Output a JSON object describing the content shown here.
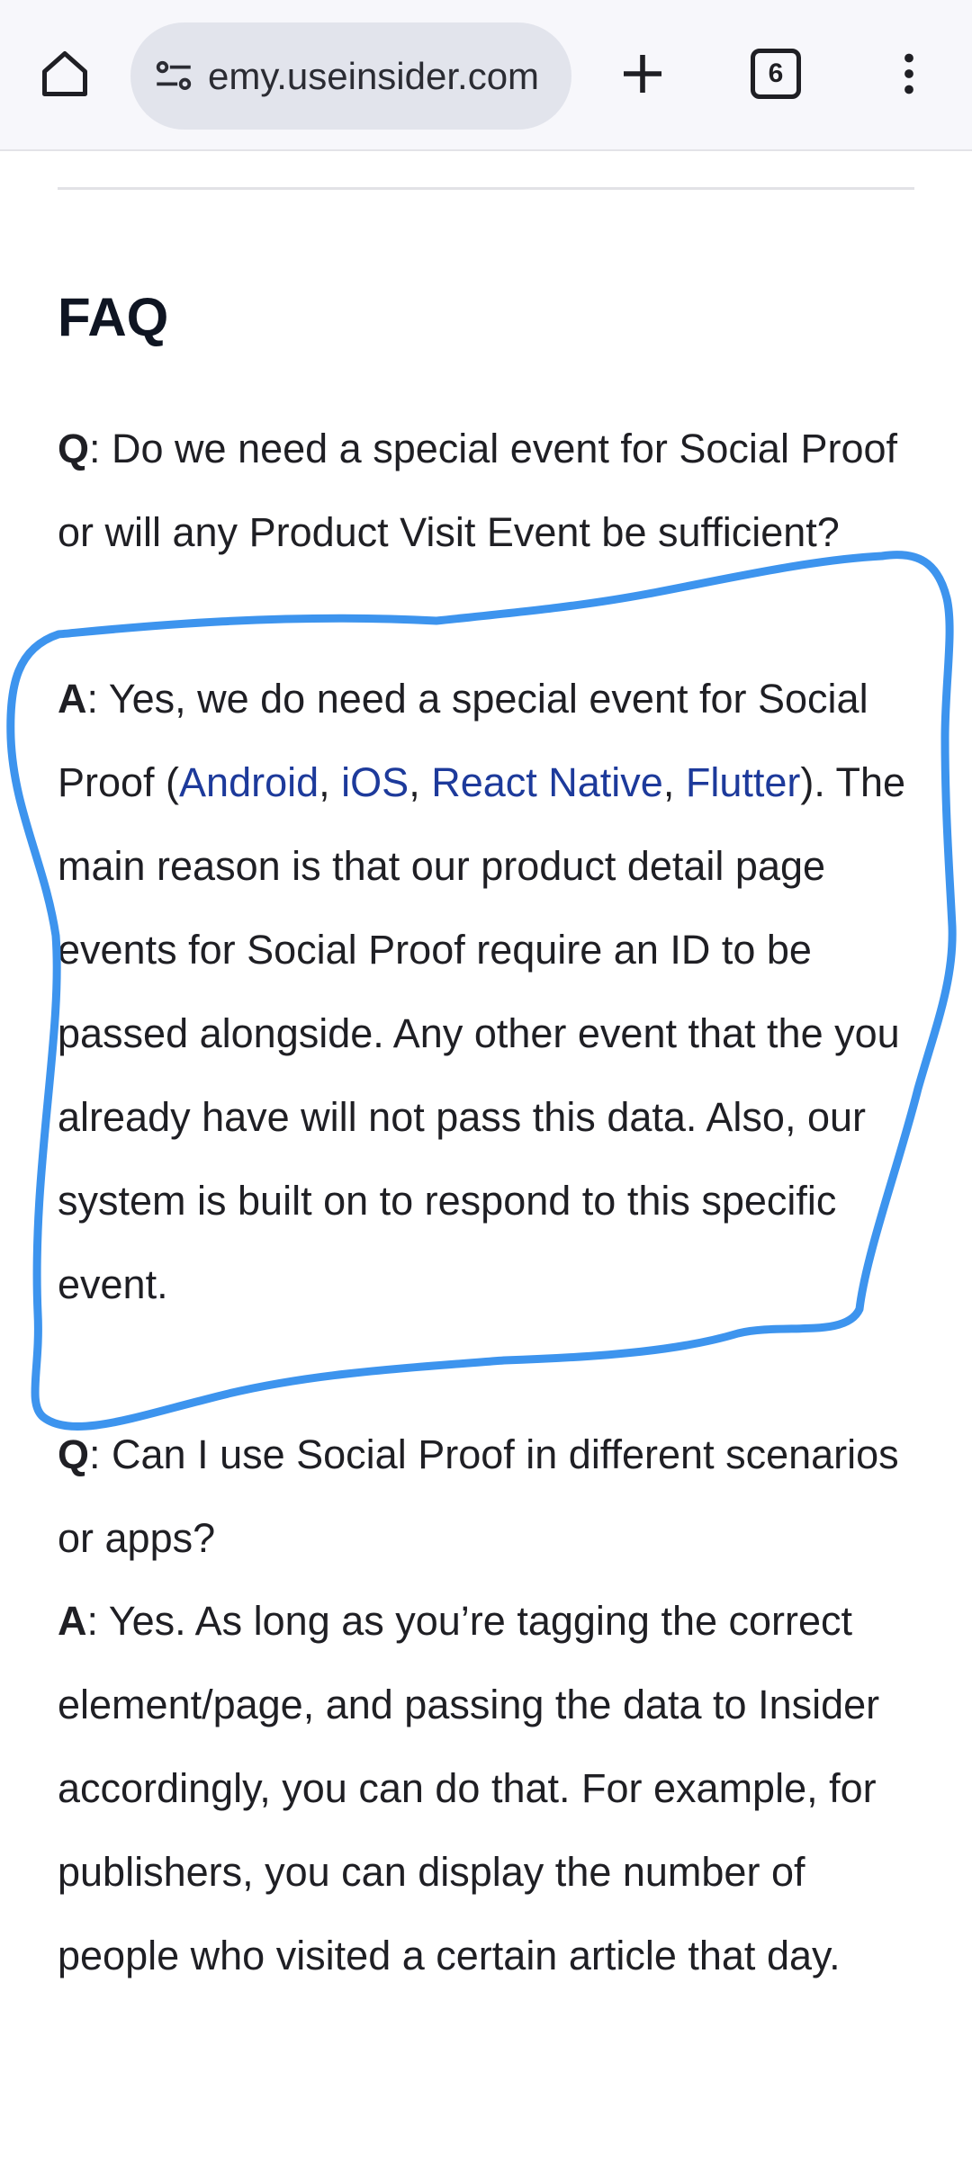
{
  "browser": {
    "url": "emy.useinsider.com",
    "tab_count": "6",
    "icons": {
      "home": "home-icon",
      "site_info": "tune-icon",
      "new_tab": "plus-icon",
      "menu": "more-vert-icon"
    }
  },
  "content": {
    "title": "FAQ",
    "faq": [
      {
        "q_label": "Q",
        "q_text": ": Do we need a special event for Social Proof or will any Product Visit Event be sufficient?",
        "a_label": "A",
        "a_intro": ": Yes, we do need a special event for Social Proof (",
        "links": [
          "Android",
          "iOS",
          "React Native",
          "Flutter"
        ],
        "sep1": ", ",
        "sep2": ", ",
        "sep3": ", ",
        "a_rest": "). The main reason is that our product detail page events for Social Proof require an ID to be passed alongside. Any other event that the you already have will not pass this data. Also, our system is built on to respond to this specific event."
      },
      {
        "q_label": "Q",
        "q_text": ": Can I use Social Proof in different scenarios or apps?",
        "a_label": "A",
        "a_text": ": Yes. As long as you’re tagging the correct element/page, and passing the data to Insider accordingly, you can do that. For example, for publishers, you can display the number of people who visited a certain article that day."
      }
    ]
  },
  "colors": {
    "link": "#1d3a9b",
    "annotation": "#3d94ee",
    "address_bar": "#e2e4ec"
  }
}
